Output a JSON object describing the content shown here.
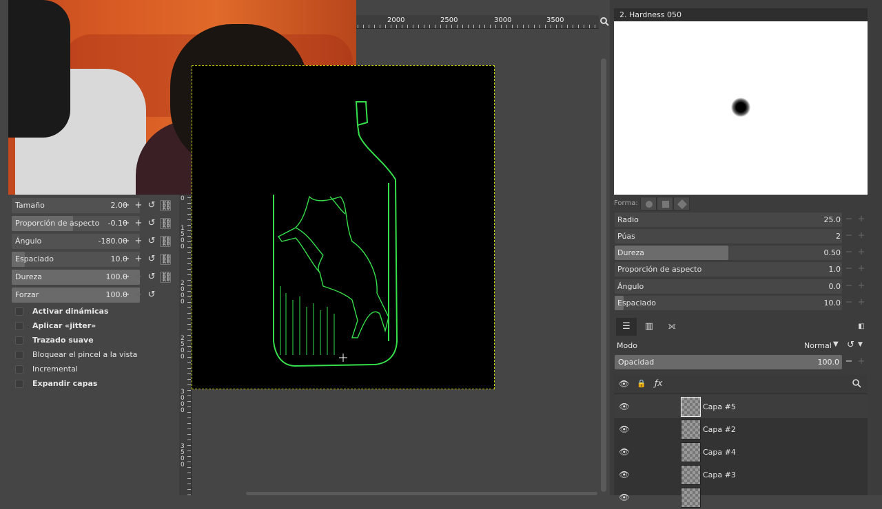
{
  "ruler_top": {
    "labels": [
      "2000",
      "2500",
      "3000",
      "3500"
    ]
  },
  "ruler_left": {
    "labels": [
      "0",
      "1\n5\n0\n0",
      "2\n0\n0\n0",
      "2\n5\n0\n0",
      "3\n0\n0\n0",
      "3\n5\n0\n0"
    ]
  },
  "tool_options": {
    "sliders": [
      {
        "name": "Tamaño",
        "value": "2.00",
        "fill_percent": 0
      },
      {
        "name": "Proporción de aspecto",
        "value": "-0.10",
        "fill_percent": 48
      },
      {
        "name": "Ángulo",
        "value": "-180.00",
        "fill_percent": 0
      },
      {
        "name": "Espaciado",
        "value": "10.0",
        "fill_percent": 10
      },
      {
        "name": "Dureza",
        "value": "100.0",
        "fill_percent": 100
      },
      {
        "name": "Forzar",
        "value": "100.0",
        "fill_percent": 100
      }
    ],
    "checkboxes": [
      {
        "label": "Activar dinámicas",
        "bold": true
      },
      {
        "label": "Aplicar «jitter»",
        "bold": true
      },
      {
        "label": "Trazado suave",
        "bold": true
      },
      {
        "label": "Bloquear el pincel a la vista",
        "bold": false
      },
      {
        "label": "Incremental",
        "bold": false
      },
      {
        "label": "Expandir capas",
        "bold": true
      }
    ]
  },
  "brush_editor": {
    "title": "2. Hardness 050",
    "shape_label": "Forma:",
    "params": [
      {
        "name": "Radio",
        "value": "25.0",
        "fill_percent": 0
      },
      {
        "name": "Púas",
        "value": "2",
        "fill_percent": 0
      },
      {
        "name": "Dureza",
        "value": "0.50",
        "fill_percent": 50
      },
      {
        "name": "Proporción de aspecto",
        "value": "1.0",
        "fill_percent": 0
      },
      {
        "name": "Ángulo",
        "value": "0.0",
        "fill_percent": 0
      },
      {
        "name": "Espaciado",
        "value": "10.0",
        "fill_percent": 4
      }
    ]
  },
  "layers": {
    "mode_label": "Modo",
    "mode_value": "Normal",
    "opacity_label": "Opacidad",
    "opacity_value": "100.0",
    "items": [
      {
        "name": "Capa #5",
        "selected": true
      },
      {
        "name": "Capa #2",
        "selected": false
      },
      {
        "name": "Capa #4",
        "selected": false
      },
      {
        "name": "Capa #3",
        "selected": false
      }
    ]
  },
  "colors": {
    "line_art": "#35e04a",
    "selection_border": "#c8d400",
    "canvas": "#000000"
  },
  "icons": [
    "search-icon",
    "plus-icon",
    "minus-icon",
    "reset-icon",
    "chain-icon",
    "eye-icon",
    "lock-icon",
    "fx-icon",
    "layers-tab-icon",
    "channels-tab-icon",
    "paths-tab-icon",
    "dock-menu-icon"
  ]
}
